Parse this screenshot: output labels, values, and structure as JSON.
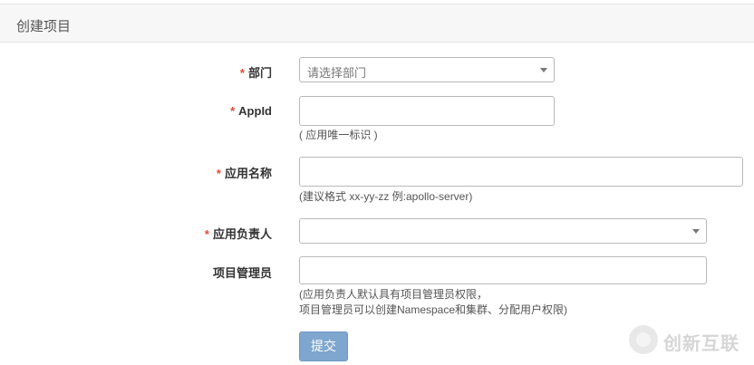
{
  "panel": {
    "title": "创建项目"
  },
  "form": {
    "required_mark": "*",
    "department": {
      "label": "部门",
      "placeholder": "请选择部门"
    },
    "appid": {
      "label": "AppId",
      "help": "( 应用唯一标识 )"
    },
    "app_name": {
      "label": "应用名称",
      "help": "(建议格式 xx-yy-zz 例:apollo-server)"
    },
    "owner": {
      "label": "应用负责人"
    },
    "admins": {
      "label": "项目管理员",
      "help_line1": "(应用负责人默认具有项目管理员权限，",
      "help_line2": "项目管理员可以创建Namespace和集群、分配用户权限)"
    },
    "submit_label": "提交"
  },
  "watermark": {
    "text": "创新互联"
  }
}
